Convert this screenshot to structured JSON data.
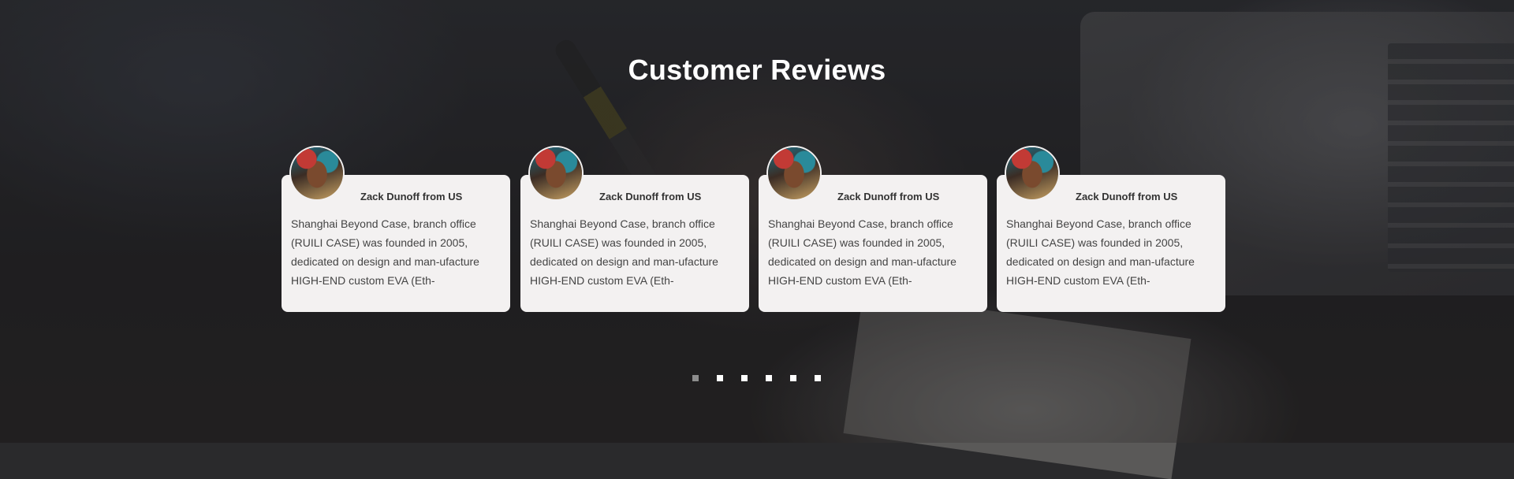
{
  "section": {
    "title": "Customer Reviews"
  },
  "reviews": [
    {
      "author": "Zack Dunoff from US",
      "text": "Shanghai Beyond Case, branch office (RUILI CASE) was founded in 2005, dedicated on design and man-ufacture HIGH-END custom EVA (Eth-"
    },
    {
      "author": "Zack Dunoff from US",
      "text": "Shanghai Beyond Case, branch office (RUILI CASE) was founded in 2005, dedicated on design and man-ufacture HIGH-END custom EVA (Eth-"
    },
    {
      "author": "Zack Dunoff from US",
      "text": "Shanghai Beyond Case, branch office (RUILI CASE) was founded in 2005, dedicated on design and man-ufacture HIGH-END custom EVA (Eth-"
    },
    {
      "author": "Zack Dunoff from US",
      "text": "Shanghai Beyond Case, branch office (RUILI CASE) was founded in 2005, dedicated on design and man-ufacture HIGH-END custom EVA (Eth-"
    }
  ],
  "pagination": {
    "count": 6,
    "active_index": 0
  },
  "icons": {
    "avatar": "avatar-photo"
  },
  "colors": {
    "title": "#ffffff",
    "card_background": "#f3f1f1",
    "dot_inactive": "#ffffff",
    "dot_active": "#8d8d8d"
  }
}
